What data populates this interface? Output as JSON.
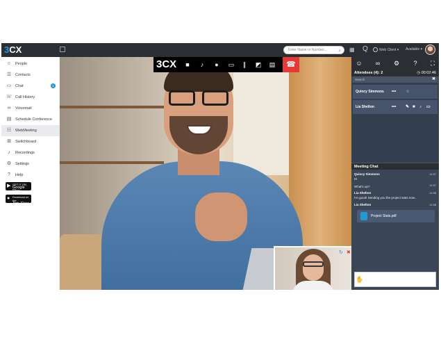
{
  "topbar": {
    "logo_three": "3",
    "logo_cx": "CX",
    "search_placeholder": "Enter Name or Number...",
    "client_label": "Web Client",
    "status_label": "Available"
  },
  "sidebar": {
    "items": [
      {
        "icon": "person-icon",
        "label": "People"
      },
      {
        "icon": "contacts-icon",
        "label": "Contacts"
      },
      {
        "icon": "chat-icon",
        "label": "Chat",
        "badge": "1"
      },
      {
        "icon": "call-history-icon",
        "label": "Call History"
      },
      {
        "icon": "voicemail-icon",
        "label": "Voicemail"
      },
      {
        "icon": "calendar-icon",
        "label": "Schedule Conference"
      },
      {
        "icon": "webmeeting-icon",
        "label": "WebMeeting"
      },
      {
        "icon": "switchboard-icon",
        "label": "Switchboard"
      },
      {
        "icon": "microphone-icon",
        "label": "Recordings"
      },
      {
        "icon": "gear-icon",
        "label": "Settings"
      },
      {
        "icon": "help-icon",
        "label": "Help"
      }
    ],
    "google_play": {
      "small": "GET IT ON",
      "big": "Google Play"
    },
    "app_store": {
      "small": "Download on the",
      "big": "App Store"
    }
  },
  "call_toolbar": {
    "logo_three": "3",
    "logo_cx": "CX"
  },
  "rpanel": {
    "attendees_label": "Attendees (4): 2",
    "timer": "00:02:46",
    "search_placeholder": "Search",
    "attendees": [
      {
        "name": "Quincy Simmons"
      },
      {
        "name": "Lia Shelton"
      }
    ],
    "chat_title": "Meeting Chat",
    "messages": [
      {
        "name": "Quincy Simmons",
        "time": "11:57",
        "text": "Hi"
      },
      {
        "name": "",
        "time": "11:57",
        "text": "What's up?"
      },
      {
        "name": "Lia Shelton",
        "time": "11:58",
        "text": "I'm good! Sending you the project stats now..."
      },
      {
        "name": "Lia Shelton",
        "time": "11:58",
        "text": ""
      }
    ],
    "file_name": "Project Stats.pdf"
  },
  "colors": {
    "accent": "#1e9bd7",
    "topbar": "#2b2e33",
    "panel": "#3a4556",
    "hangup": "#e53935"
  }
}
